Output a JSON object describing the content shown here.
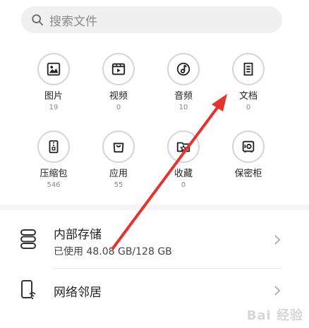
{
  "search": {
    "placeholder": "搜索文件"
  },
  "categories": [
    {
      "label": "图片",
      "count": "19",
      "icon": "image-icon"
    },
    {
      "label": "视频",
      "count": "0",
      "icon": "video-icon"
    },
    {
      "label": "音频",
      "count": "10",
      "icon": "audio-icon"
    },
    {
      "label": "文档",
      "count": "0",
      "icon": "document-icon"
    },
    {
      "label": "压缩包",
      "count": "546",
      "icon": "zip-icon"
    },
    {
      "label": "应用",
      "count": "55",
      "icon": "app-bag-icon"
    },
    {
      "label": "收藏",
      "count": "0",
      "icon": "favorite-folder-icon"
    },
    {
      "label": "保密柜",
      "count": "",
      "icon": "safe-icon"
    }
  ],
  "storage": {
    "title": "内部存储",
    "usage": "已使用 48.08 GB/128 GB",
    "used_gb": 48.08,
    "total_gb": 128
  },
  "network": {
    "title": "网络邻居"
  },
  "watermark": {
    "text": "Bai 经验"
  },
  "colors": {
    "accent_arrow": "#e8322e",
    "icon_stroke": "#222222",
    "circle_border": "#d6d6d6"
  }
}
